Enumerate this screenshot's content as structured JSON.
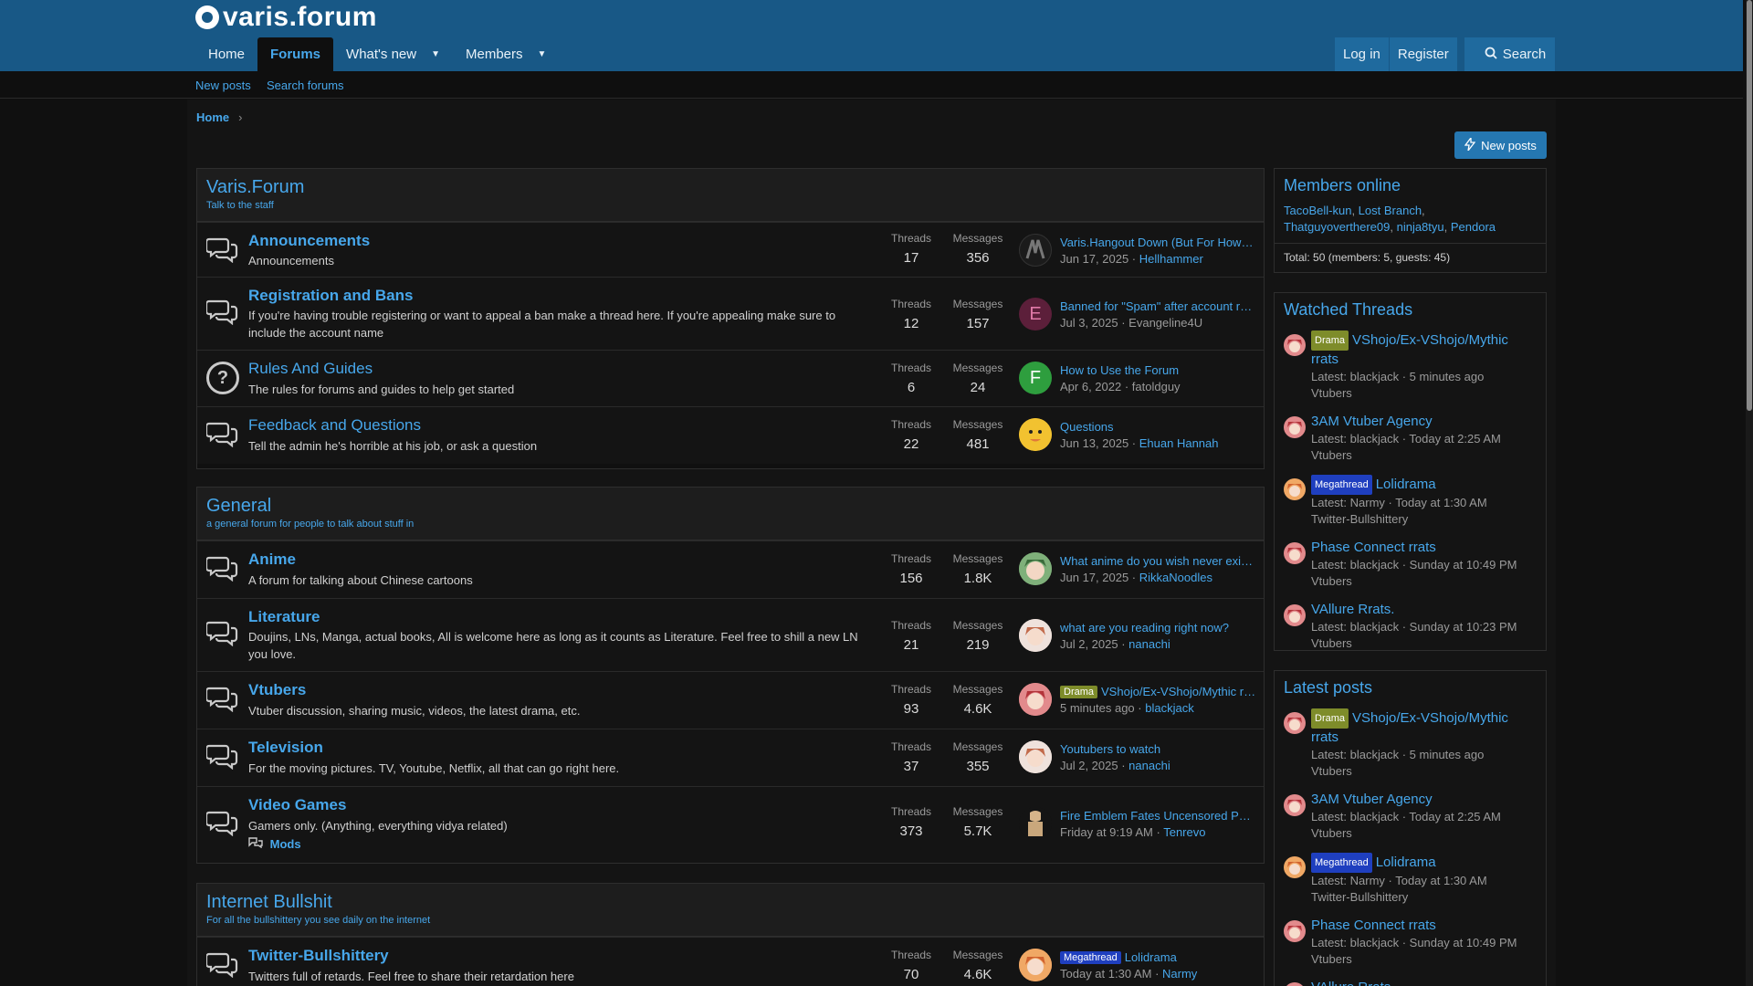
{
  "site": {
    "logo_text": "varis.forum"
  },
  "nav": {
    "tabs": [
      {
        "label": "Home"
      },
      {
        "label": "Forums"
      },
      {
        "label": "What's new"
      },
      {
        "label": "Members"
      }
    ],
    "login": "Log in",
    "register": "Register",
    "search": "Search"
  },
  "subnav": {
    "new_posts": "New posts",
    "search_forums": "Search forums"
  },
  "breadcrumb": {
    "home": "Home"
  },
  "new_posts_button": "New posts",
  "categories": [
    {
      "title": "Varis.Forum",
      "desc": "Talk to the staff",
      "nodes": [
        {
          "title": "Announcements",
          "desc": "Announcements",
          "threads_label": "Threads",
          "threads": "17",
          "messages_label": "Messages",
          "messages": "356",
          "lp_title": "Varis.Hangout Down (But For How Long?)",
          "lp_date": "Jun 17, 2025",
          "lp_user": "Hellhammer"
        },
        {
          "title": "Registration and Bans",
          "desc": "If you're having trouble registering or want to appeal a ban make a thread here. If you're appealing make sure to include the account name",
          "threads_label": "Threads",
          "threads": "12",
          "messages_label": "Messages",
          "messages": "157",
          "lp_title": "Banned for \"Spam\" after account registration",
          "lp_date": "Jul 3, 2025",
          "lp_user": "Evangeline4U",
          "lp_avatar": "E"
        },
        {
          "title": "Rules And Guides",
          "desc": "The rules for forums and guides to help get started",
          "threads_label": "Threads",
          "threads": "6",
          "messages_label": "Messages",
          "messages": "24",
          "lp_title": "How to Use the Forum",
          "lp_date": "Apr 6, 2022",
          "lp_user": "fatoldguy",
          "lp_avatar": "F"
        },
        {
          "title": "Feedback and Questions",
          "desc": "Tell the admin he's horrible at his job, or ask a question",
          "threads_label": "Threads",
          "threads": "22",
          "messages_label": "Messages",
          "messages": "481",
          "lp_title": "Questions",
          "lp_date": "Jun 13, 2025",
          "lp_user": "Ehuan Hannah"
        }
      ]
    },
    {
      "title": "General",
      "desc": "a general forum for people to talk about stuff in",
      "nodes": [
        {
          "title": "Anime",
          "desc": "A forum for talking about Chinese cartoons",
          "threads_label": "Threads",
          "threads": "156",
          "messages_label": "Messages",
          "messages": "1.8K",
          "lp_title": "What anime do you wish never existed?",
          "lp_date": "Jun 17, 2025",
          "lp_user": "RikkaNoodles"
        },
        {
          "title": "Literature",
          "desc": "Doujins, LNs, Manga, actual books, All is welcome here as long as it counts as Literature. Feel free to shill a new LN you love.",
          "threads_label": "Threads",
          "threads": "21",
          "messages_label": "Messages",
          "messages": "219",
          "lp_title": "what are you reading right now?",
          "lp_date": "Jul 2, 2025",
          "lp_user": "nanachi"
        },
        {
          "title": "Vtubers",
          "desc": "Vtuber discussion, sharing music, videos, the latest drama, etc.",
          "threads_label": "Threads",
          "threads": "93",
          "messages_label": "Messages",
          "messages": "4.6K",
          "lp_label": "Drama",
          "lp_title": "VShojo/Ex-VShojo/Mythic rrats",
          "lp_date": "5 minutes ago",
          "lp_user": "blackjack"
        },
        {
          "title": "Television",
          "desc": "For the moving pictures. TV, Youtube, Netflix, all that can go right here.",
          "threads_label": "Threads",
          "threads": "37",
          "messages_label": "Messages",
          "messages": "355",
          "lp_title": "Youtubers to watch",
          "lp_date": "Jul 2, 2025",
          "lp_user": "nanachi"
        },
        {
          "title": "Video Games",
          "desc": "Gamers only. (Anything, everything vidya related)",
          "sub": "Mods",
          "threads_label": "Threads",
          "threads": "373",
          "messages_label": "Messages",
          "messages": "5.7K",
          "lp_title": "Fire Emblem Fates Uncensored Patch",
          "lp_date": "Friday at 9:19 AM",
          "lp_user": "Tenrevo"
        }
      ]
    },
    {
      "title": "Internet Bullshit",
      "desc": "For all the bullshittery you see daily on the internet",
      "nodes": [
        {
          "title": "Twitter-Bullshittery",
          "desc": "Twitters full of retards. Feel free to share their retardation here",
          "threads_label": "Threads",
          "threads": "70",
          "messages_label": "Messages",
          "messages": "4.6K",
          "lp_label": "Megathread",
          "lp_title": "Lolidrama",
          "lp_date": "Today at 1:30 AM",
          "lp_user": "Narmy"
        }
      ]
    }
  ],
  "members_online": {
    "title": "Members online",
    "members": [
      "TacoBell-kun",
      "Lost Branch",
      "Thatguyoverthere09",
      "ninja8tyu",
      "Pendora"
    ],
    "total": "Total: 50 (members: 5, guests: 45)"
  },
  "watched_threads": {
    "title": "Watched Threads",
    "items": [
      {
        "label": "Drama",
        "title": "VShojo/Ex-VShojo/Mythic rrats",
        "meta": "Latest: blackjack · 5 minutes ago",
        "forum": "Vtubers"
      },
      {
        "title": "3AM Vtuber Agency",
        "meta": "Latest: blackjack · Today at 2:25 AM",
        "forum": "Vtubers"
      },
      {
        "label": "Megathread",
        "title": "Lolidrama",
        "meta": "Latest: Narmy · Today at 1:30 AM",
        "forum": "Twitter-Bullshittery"
      },
      {
        "title": "Phase Connect rrats",
        "meta": "Latest: blackjack · Sunday at 10:49 PM",
        "forum": "Vtubers"
      },
      {
        "title": "VAllure Rrats.",
        "meta": "Latest: blackjack · Sunday at 10:23 PM",
        "forum": "Vtubers"
      }
    ]
  },
  "latest_posts": {
    "title": "Latest posts",
    "items": [
      {
        "label": "Drama",
        "title": "VShojo/Ex-VShojo/Mythic rrats",
        "meta": "Latest: blackjack · 5 minutes ago",
        "forum": "Vtubers"
      },
      {
        "title": "3AM Vtuber Agency",
        "meta": "Latest: blackjack · Today at 2:25 AM",
        "forum": "Vtubers"
      },
      {
        "label": "Megathread",
        "title": "Lolidrama",
        "meta": "Latest: Narmy · Today at 1:30 AM",
        "forum": "Twitter-Bullshittery"
      },
      {
        "title": "Phase Connect rrats",
        "meta": "Latest: blackjack · Sunday at 10:49 PM",
        "forum": "Vtubers"
      },
      {
        "title": "VAllure Rrats."
      }
    ]
  },
  "colors": {
    "accent": "#47a7eb",
    "header": "#185886",
    "drama_label": "#7e8c2a",
    "mega_label": "#1f3fbf"
  }
}
